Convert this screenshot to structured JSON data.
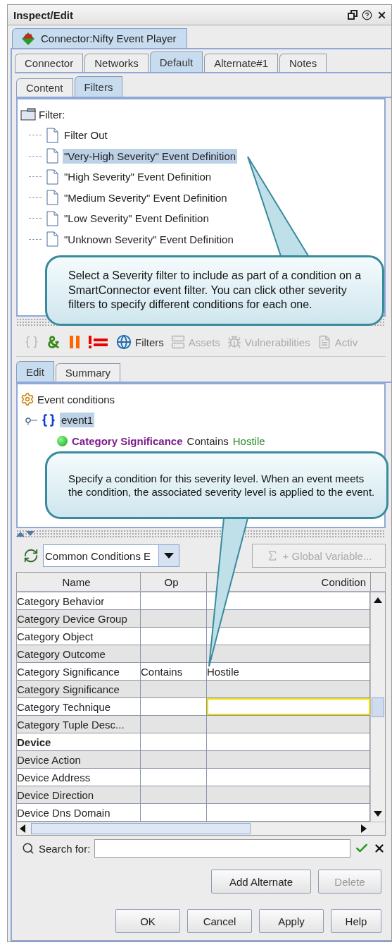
{
  "window": {
    "title": "Inspect/Edit"
  },
  "resource_tab": {
    "label": "Connector:Nifty Event Player"
  },
  "tabs": [
    {
      "label": "Connector",
      "selected": false
    },
    {
      "label": "Networks",
      "selected": false
    },
    {
      "label": "Default",
      "selected": true
    },
    {
      "label": "Alternate#1",
      "selected": false
    },
    {
      "label": "Notes",
      "selected": false
    }
  ],
  "subtabs": [
    {
      "label": "Content",
      "selected": false
    },
    {
      "label": "Filters",
      "selected": true
    }
  ],
  "filter_tree": {
    "root": "Filter:",
    "children": [
      {
        "label": "Filter Out",
        "selected": false
      },
      {
        "label": "\"Very-High Severity\" Event Definition",
        "selected": true
      },
      {
        "label": "\"High Severity\" Event Definition",
        "selected": false
      },
      {
        "label": "\"Medium Severity\" Event Definition",
        "selected": false
      },
      {
        "label": "\"Low Severity\" Event Definition",
        "selected": false
      },
      {
        "label": "\"Unknown Severity\" Event Definition",
        "selected": false
      }
    ]
  },
  "toolbar": [
    {
      "kind": "braces",
      "disabled": true
    },
    {
      "kind": "and",
      "disabled": false
    },
    {
      "kind": "or",
      "disabled": false
    },
    {
      "kind": "not",
      "disabled": false
    },
    {
      "kind": "filters",
      "label": "Filters",
      "disabled": false
    },
    {
      "kind": "assets",
      "label": "Assets",
      "disabled": true
    },
    {
      "kind": "vulnerabilities",
      "label": "Vulnerabilities",
      "disabled": true
    },
    {
      "kind": "active",
      "label": "Activ",
      "disabled": true
    }
  ],
  "editor_tabs": [
    {
      "label": "Edit",
      "selected": true
    },
    {
      "label": "Summary",
      "selected": false
    }
  ],
  "conditions": {
    "root": "Event conditions",
    "children": [
      {
        "label": "event1",
        "selected": true,
        "children": [
          {
            "field": "Category Significance",
            "operator": "Contains",
            "value": "Hostile"
          }
        ]
      }
    ]
  },
  "combo": {
    "value": "Common Conditions E"
  },
  "global_variable_button": {
    "label": "+ Global Variable...",
    "disabled": true
  },
  "table": {
    "columns": [
      "Name",
      "Op",
      "Condition"
    ],
    "rows": [
      {
        "name": "Category Behavior",
        "op": "",
        "condition": "",
        "kind": "field",
        "focused": false
      },
      {
        "name": "Category Device Group",
        "op": "",
        "condition": "",
        "kind": "field",
        "focused": false
      },
      {
        "name": "Category Object",
        "op": "",
        "condition": "",
        "kind": "field",
        "focused": false
      },
      {
        "name": "Category Outcome",
        "op": "",
        "condition": "",
        "kind": "field",
        "focused": false
      },
      {
        "name": "Category Significance",
        "op": "Contains",
        "condition": "Hostile",
        "kind": "field",
        "focused": false
      },
      {
        "name": "Category Significance",
        "op": "",
        "condition": "",
        "kind": "field",
        "focused": false
      },
      {
        "name": "Category Technique",
        "op": "",
        "condition": "",
        "kind": "field",
        "focused": true
      },
      {
        "name": "Category Tuple Desc...",
        "op": "",
        "condition": "",
        "kind": "field",
        "focused": false
      },
      {
        "name": "Device",
        "op": "",
        "condition": "",
        "kind": "group",
        "focused": false
      },
      {
        "name": "Device Action",
        "op": "",
        "condition": "",
        "kind": "field",
        "focused": false
      },
      {
        "name": "Device Address",
        "op": "",
        "condition": "",
        "kind": "field",
        "focused": false
      },
      {
        "name": "Device Direction",
        "op": "",
        "condition": "",
        "kind": "field",
        "focused": false
      },
      {
        "name": "Device Dns Domain",
        "op": "",
        "condition": "",
        "kind": "field",
        "focused": false
      }
    ]
  },
  "search": {
    "label": "Search for:"
  },
  "panel_buttons": [
    {
      "label": "Add Alternate",
      "disabled": false
    },
    {
      "label": "Delete",
      "disabled": true
    }
  ],
  "dialog_buttons": [
    {
      "label": "OK"
    },
    {
      "label": "Cancel"
    },
    {
      "label": "Apply"
    },
    {
      "label": "Help"
    }
  ],
  "callouts": [
    {
      "text": "Select a Severity filter to include as part of a condition on a SmartConnector event filter. You can click other severity filters to specify different conditions for each one."
    },
    {
      "text": "Specify a condition for this severity level. When an event meets the condition, the associated severity level is applied to the event."
    }
  ]
}
